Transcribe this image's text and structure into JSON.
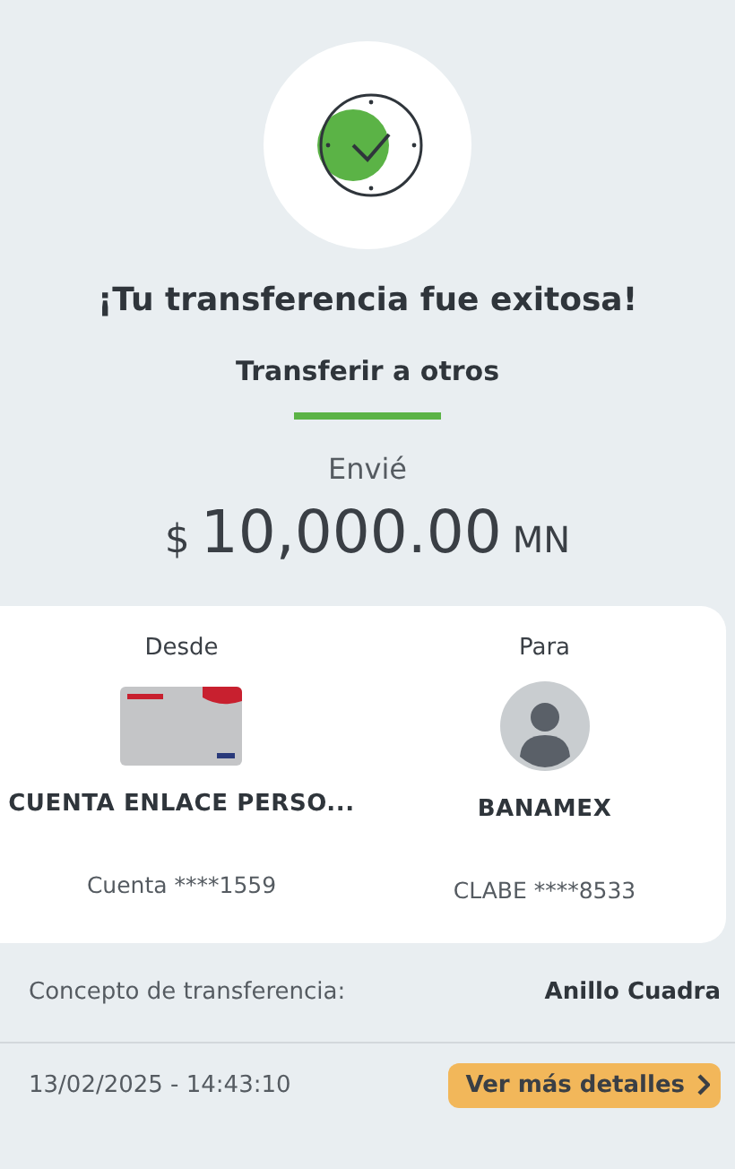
{
  "title": "¡Tu transferencia fue exitosa!",
  "subtitle": "Transferir a otros",
  "sent_label": "Envié",
  "amount": {
    "currency": "$",
    "value": "10,000.00",
    "unit": "MN"
  },
  "from": {
    "label": "Desde",
    "name": "CUENTA ENLACE PERSO...",
    "account": "Cuenta ****1559"
  },
  "to": {
    "label": "Para",
    "name": "BANAMEX",
    "account": "CLABE ****8533"
  },
  "concept": {
    "label": "Concepto de transferencia:",
    "value": "Anillo Cuadra"
  },
  "date": "13/02/2025 - 14:43:10",
  "details_button": "Ver más detalles"
}
